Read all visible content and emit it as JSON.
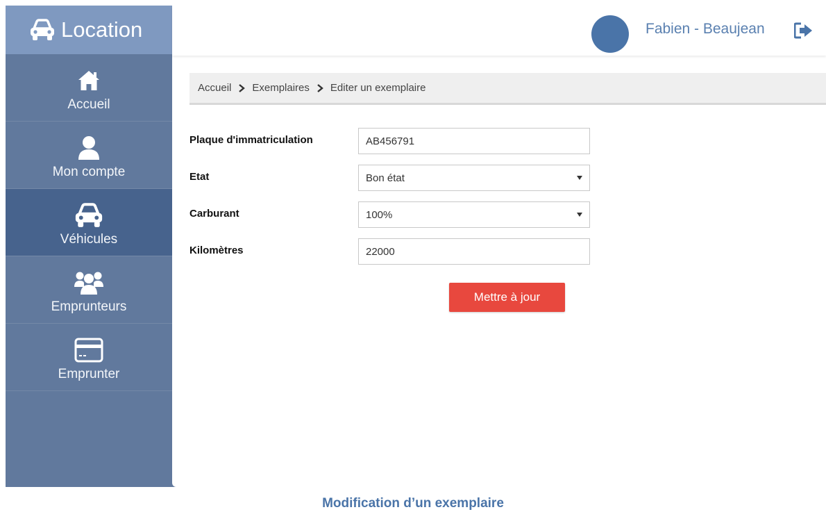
{
  "app": {
    "brand": "Location"
  },
  "sidebar": {
    "items": [
      {
        "label": "Accueil",
        "icon": "home-icon"
      },
      {
        "label": "Mon compte",
        "icon": "user-icon"
      },
      {
        "label": "Véhicules",
        "icon": "car-icon",
        "active": true
      },
      {
        "label": "Emprunteurs",
        "icon": "users-icon"
      },
      {
        "label": "Emprunter",
        "icon": "credit-card-icon"
      }
    ]
  },
  "header": {
    "username": "Fabien - Beaujean"
  },
  "breadcrumb": [
    "Accueil",
    "Exemplaires",
    "Editer un exemplaire"
  ],
  "form": {
    "plate": {
      "label": "Plaque d'immatriculation",
      "value": "AB456791"
    },
    "state": {
      "label": "Etat",
      "value": "Bon état"
    },
    "fuel": {
      "label": "Carburant",
      "value": "100%"
    },
    "km": {
      "label": "Kilomètres",
      "value": "22000"
    },
    "submit_label": "Mettre à jour"
  },
  "caption": "Modification d’un exemplaire",
  "colors": {
    "sidebar": "#61799d",
    "brand_bar": "#7f99c0",
    "active_item": "#47638d",
    "accent": "#4a74a8",
    "button": "#e8483e"
  }
}
